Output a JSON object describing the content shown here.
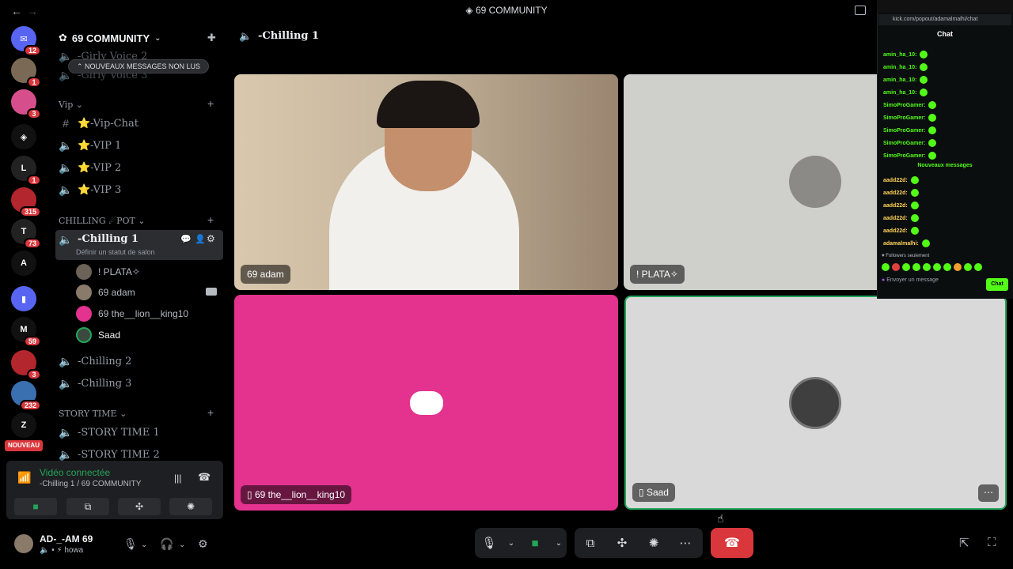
{
  "titlebar": {
    "back": "←",
    "forward": "→",
    "title": "69 COMMUNITY",
    "logo": "◈"
  },
  "rail": {
    "servers": [
      {
        "id": "home",
        "glyph": "✉",
        "color": "#5865f2",
        "badge": "12"
      },
      {
        "id": "s1",
        "glyph": "",
        "color": "#7a6a55",
        "badge": "1"
      },
      {
        "id": "s2",
        "glyph": "",
        "color": "#d64f8c",
        "badge": "3"
      },
      {
        "id": "s3",
        "glyph": "◈",
        "color": "#111111",
        "badge": ""
      },
      {
        "id": "s4",
        "glyph": "L",
        "color": "#222222",
        "badge": "1"
      },
      {
        "id": "s5",
        "glyph": "",
        "color": "#b3262d",
        "badge": "315"
      },
      {
        "id": "s6",
        "glyph": "T",
        "color": "#222222",
        "badge": "73"
      },
      {
        "id": "s7",
        "glyph": "A",
        "color": "#111111",
        "badge": ""
      },
      {
        "id": "s8",
        "glyph": "▮",
        "color": "#5865f2",
        "badge": ""
      },
      {
        "id": "s9",
        "glyph": "M",
        "color": "#111111",
        "badge": "59"
      },
      {
        "id": "s10",
        "glyph": "",
        "color": "#b3262d",
        "badge": "3"
      },
      {
        "id": "s11",
        "glyph": "",
        "color": "#3a6fb0",
        "badge": "232"
      },
      {
        "id": "s12",
        "glyph": "Z",
        "color": "#111111",
        "badge": ""
      }
    ],
    "nouveau": "NOUVEAU"
  },
  "sidebar": {
    "server_name": "69 COMMUNITY",
    "unread_banner": "NOUVEAUX MESSAGES NON LUS",
    "top_channels": [
      "-Girly Voice 2",
      "-Girly Voice 3"
    ],
    "category_vip": "Vip",
    "vip_channels": [
      "⭐-Vip-Chat",
      "⭐-VIP 1",
      "⭐-VIP 2",
      "⭐-VIP 3"
    ],
    "category_chilling": "CHILLING ☄POT",
    "active_channel": "-Chilling 1",
    "set_status": "Définir un statut de salon",
    "members": [
      "! PLATA✧",
      "69 adam",
      "69 the__lion__king10",
      "Saad"
    ],
    "chilling_channels": [
      "-Chilling 2",
      "-Chilling 3"
    ],
    "category_story": "STORY TIME",
    "story_channels": [
      "-STORY TIME 1",
      "-STORY TIME 2"
    ]
  },
  "voice": {
    "status": "Vidéo connectée",
    "sub": "-Chilling 1 / 69 COMMUNITY"
  },
  "user": {
    "name": "AD-_-AM 69",
    "status": "howa"
  },
  "main": {
    "channel_title": "-Chilling 1",
    "tiles": [
      {
        "label": "69 adam"
      },
      {
        "label": "! PLATA✧"
      },
      {
        "label": "69 the__lion__king10"
      },
      {
        "label": "Saad"
      }
    ]
  },
  "chat": {
    "url": "kick.com/popout/adamalmalhi/chat",
    "title": "Chat",
    "messages": [
      {
        "user": "amin_ha_10:",
        "color": "#53fc18"
      },
      {
        "user": "amin_ha_10:",
        "color": "#53fc18"
      },
      {
        "user": "amin_ha_10:",
        "color": "#53fc18"
      },
      {
        "user": "amin_ha_10:",
        "color": "#53fc18"
      },
      {
        "user": "SimoProGamer:",
        "color": "#53fc18"
      },
      {
        "user": "SimoProGamer:",
        "color": "#53fc18"
      },
      {
        "user": "SimoProGamer:",
        "color": "#53fc18"
      },
      {
        "user": "SimoProGamer:",
        "color": "#53fc18"
      },
      {
        "user": "SimoProGamer:",
        "color": "#53fc18"
      }
    ],
    "new_messages": "Nouveaux messages",
    "messages2": [
      {
        "user": "aadd22d:",
        "color": "#ffd35a"
      },
      {
        "user": "aadd22d:",
        "color": "#ffd35a"
      },
      {
        "user": "aadd22d:",
        "color": "#ffd35a"
      },
      {
        "user": "aadd22d:",
        "color": "#ffd35a"
      },
      {
        "user": "aadd22d:",
        "color": "#ffd35a"
      },
      {
        "user": "adamalmalhi:",
        "color": "#ffd35a"
      }
    ],
    "followers": "Followers seulement",
    "input_placeholder": "Envoyer un message",
    "send": "Chat"
  },
  "colors": {
    "accent": "#5865f2",
    "green": "#23a55a",
    "danger": "#da373c",
    "pink_tile": "#e4328f",
    "kick": "#53fc18"
  }
}
